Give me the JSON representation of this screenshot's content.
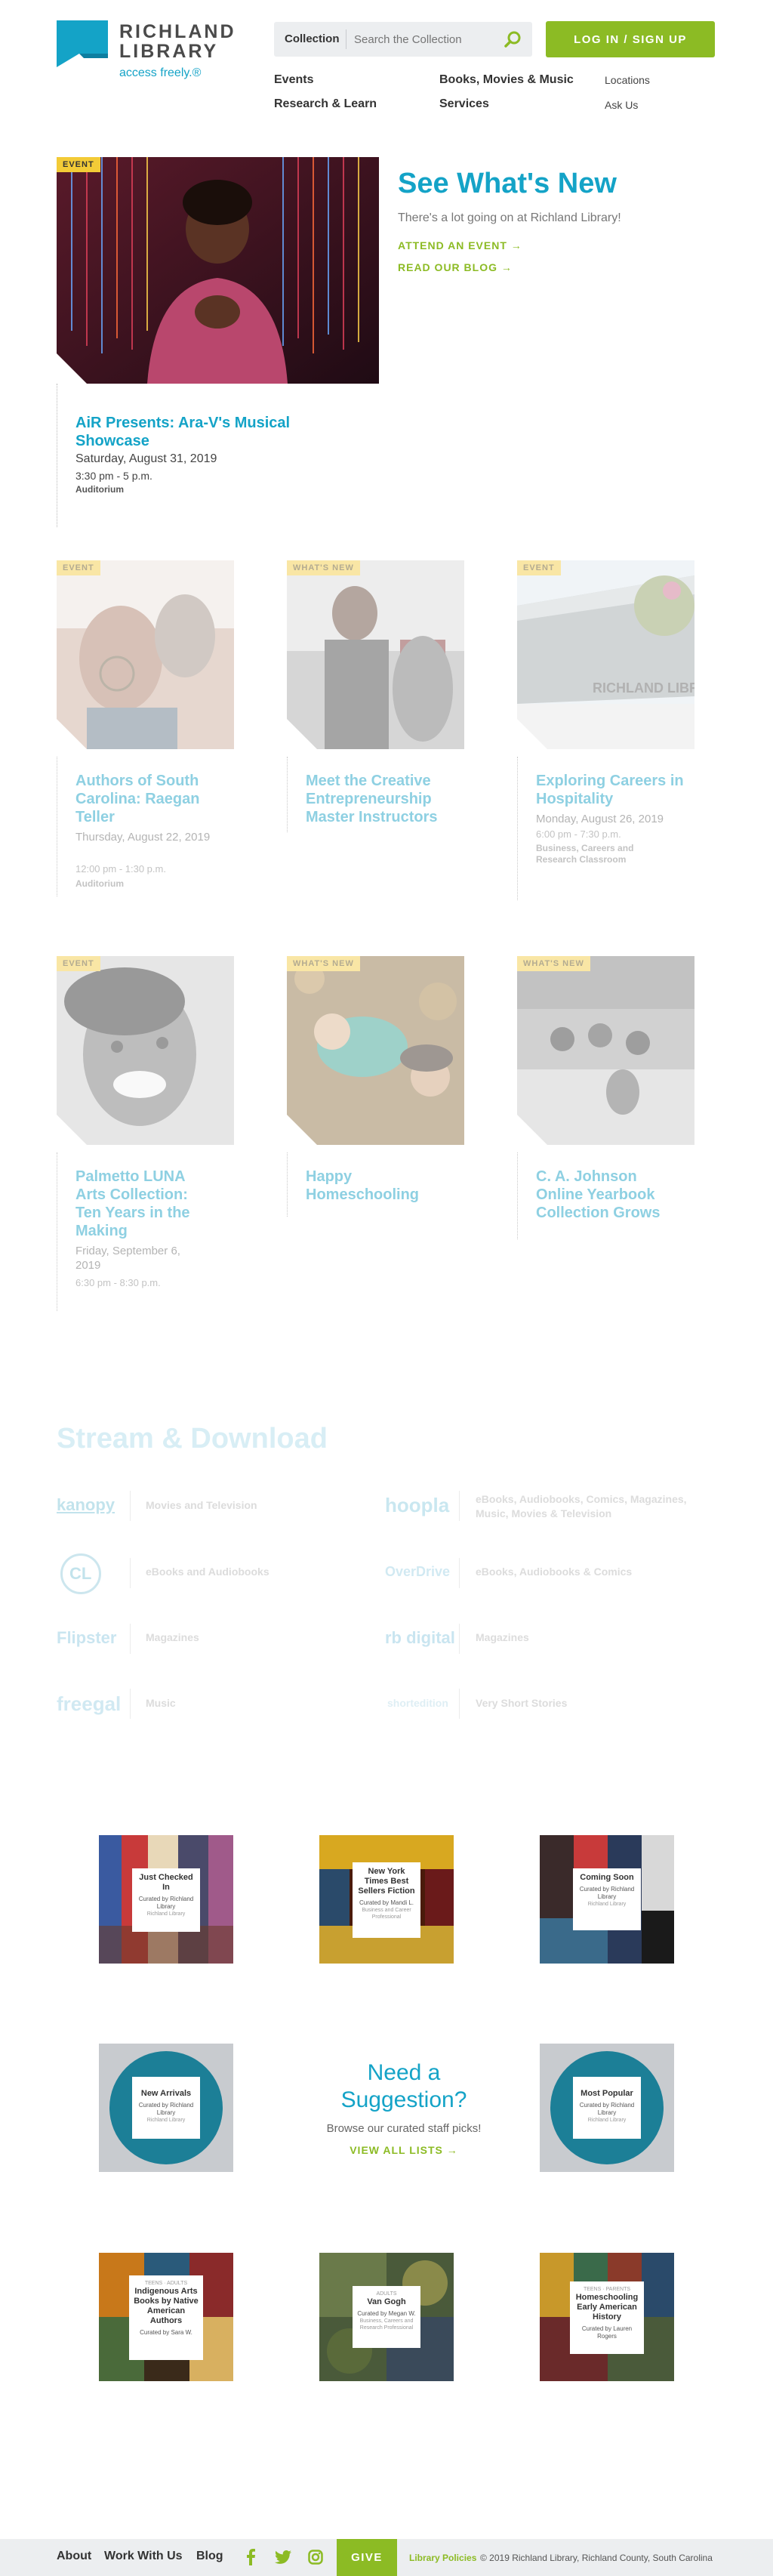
{
  "brand": {
    "name_line1": "RICHLAND",
    "name_line2": "LIBRARY",
    "tagline": "access freely.®",
    "primary_color": "#14a3c7",
    "accent_color": "#8cbb24"
  },
  "search": {
    "scope": "Collection",
    "placeholder": "Search the Collection",
    "icon": "search-icon"
  },
  "login_label": "LOG IN / SIGN UP",
  "nav": {
    "primary": [
      "Events",
      "Books, Movies & Music",
      "Research & Learn",
      "Services"
    ],
    "secondary": [
      "Locations",
      "Ask Us"
    ]
  },
  "featured": {
    "tag": "EVENT",
    "title": "AiR Presents: Ara-V's Musical Showcase",
    "date": "Saturday, August 31, 2019",
    "time": "3:30 pm - 5 p.m.",
    "location": "Auditorium"
  },
  "whats_new": {
    "title": "See What's New",
    "subtitle": "There's a lot going on at Richland Library!",
    "link1": "ATTEND AN EVENT →",
    "link2": "READ OUR BLOG →"
  },
  "cards": [
    {
      "tag": "EVENT",
      "title": "Authors of South Carolina: Raegan Teller",
      "date": "Thursday, August 22, 2019",
      "time": "12:00 pm - 1:30 p.m.",
      "location": "Auditorium"
    },
    {
      "tag": "WHAT'S NEW",
      "title": "Meet the Creative Entrepreneurship Master Instructors"
    },
    {
      "tag": "EVENT",
      "title": "Exploring Careers in Hospitality",
      "date": "Monday, August 26, 2019",
      "time": "6:00 pm - 7:30 p.m.",
      "location": "Business, Careers and Research Classroom"
    },
    {
      "tag": "EVENT",
      "title": "Palmetto LUNA Arts Collection: Ten Years in the Making",
      "date": "Friday, September 6, 2019",
      "time": "6:30 pm - 8:30 p.m."
    },
    {
      "tag": "WHAT'S NEW",
      "title": "Happy Homeschooling"
    },
    {
      "tag": "WHAT'S NEW",
      "title": "C. A. Johnson Online Yearbook Collection Grows"
    }
  ],
  "stream": {
    "title": "Stream & Download",
    "services": [
      {
        "logo": "kanopy",
        "desc": "Movies and Television"
      },
      {
        "logo": "hoopla",
        "desc": "eBooks, Audiobooks, Comics, Magazines, Music, Movies & Television"
      },
      {
        "logo": "CL",
        "desc": "eBooks and Audiobooks"
      },
      {
        "logo": "OverDrive",
        "desc": "eBooks, Audiobooks & Comics"
      },
      {
        "logo": "Flipster",
        "desc": "Magazines"
      },
      {
        "logo": "rb digital",
        "desc": "Magazines"
      },
      {
        "logo": "freegal",
        "desc": "Music"
      },
      {
        "logo": "shortedition",
        "desc": "Very Short Stories"
      }
    ]
  },
  "lists": [
    {
      "title": "Just Checked In",
      "curator": "Curated by Richland Library",
      "sub": "Richland Library"
    },
    {
      "title": "New York Times Best Sellers Fiction",
      "curator": "Curated by Mandi L.",
      "sub": "Business and Career Professional"
    },
    {
      "title": "Coming Soon",
      "curator": "Curated by Richland Library",
      "sub": "Richland Library"
    },
    {
      "title": "New Arrivals",
      "curator": "Curated by Richland Library",
      "sub": "Richland Library"
    },
    {
      "title": "Most Popular",
      "curator": "Curated by Richland Library",
      "sub": "Richland Library"
    },
    {
      "kicker": "TEENS · ADULTS",
      "title": "Indigenous Arts Books by Native American Authors",
      "curator": "Curated by Sara W."
    },
    {
      "kicker": "ADULTS",
      "title": "Van Gogh",
      "curator": "Curated by Megan W.",
      "sub": "Business, Careers and Research Professional"
    },
    {
      "kicker": "TEENS · PARENTS",
      "title": "Homeschooling Early American History",
      "curator": "Curated by Lauren Rogers"
    }
  ],
  "suggestion": {
    "title": "Need a Suggestion?",
    "subtitle": "Browse our curated staff picks!",
    "link": "VIEW ALL LISTS →"
  },
  "footer": {
    "links": [
      "About",
      "Work With Us",
      "Blog"
    ],
    "social": [
      "facebook-icon",
      "twitter-icon",
      "instagram-icon"
    ],
    "give": "GIVE",
    "policies": "Library Policies",
    "copyright": "© 2019 Richland Library, Richland County, South Carolina"
  }
}
